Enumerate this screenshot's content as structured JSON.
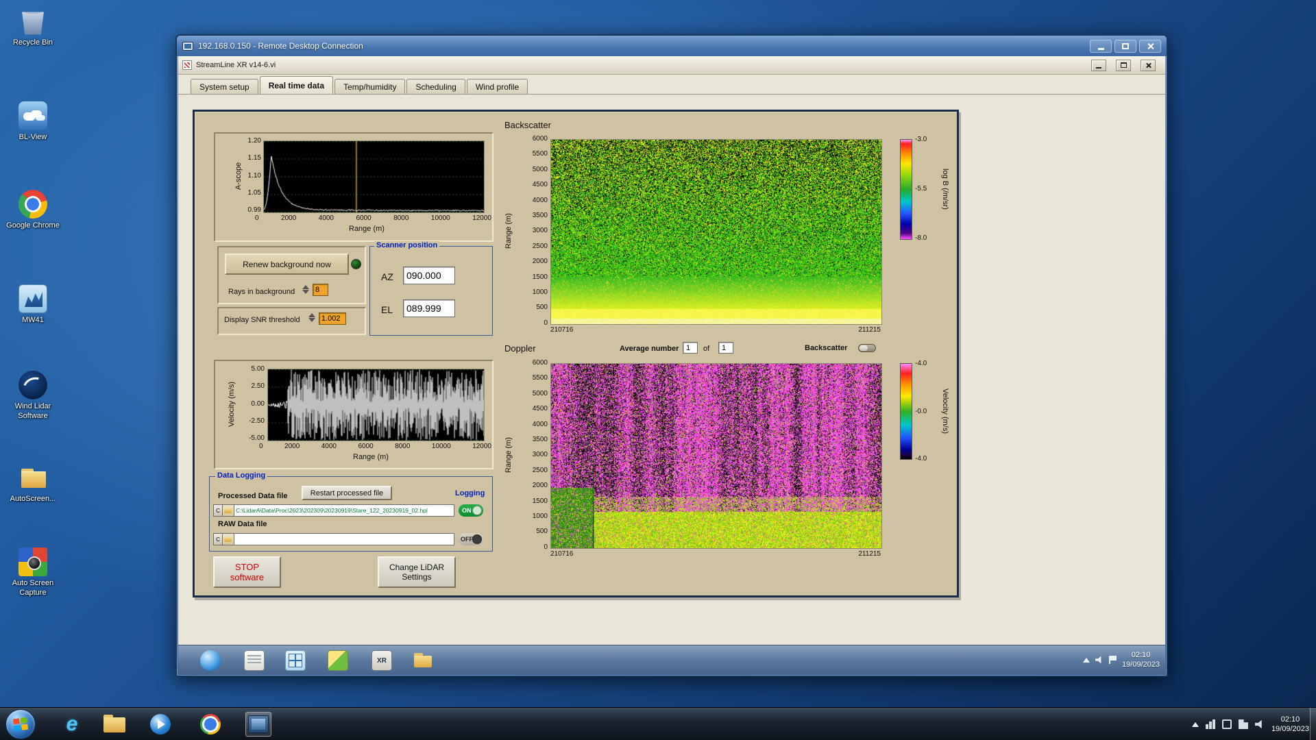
{
  "desktop": {
    "icons": [
      {
        "id": "recycle-bin",
        "label": "Recycle Bin"
      },
      {
        "id": "bl-view",
        "label": "BL-View"
      },
      {
        "id": "google-chrome",
        "label": "Google Chrome"
      },
      {
        "id": "mw41",
        "label": "MW41"
      },
      {
        "id": "wind-lidar",
        "label": "Wind Lidar Software"
      },
      {
        "id": "autoscreen",
        "label": "AutoScreen..."
      },
      {
        "id": "auto-screen-capture",
        "label": "Auto Screen Capture"
      }
    ]
  },
  "rdp": {
    "title": "192.168.0.150 - Remote Desktop Connection"
  },
  "app": {
    "title": "StreamLine XR v14-6.vi",
    "tabs": [
      {
        "label": "System setup"
      },
      {
        "label": "Real time data"
      },
      {
        "label": "Temp/humidity"
      },
      {
        "label": "Scheduling"
      },
      {
        "label": "Wind profile"
      }
    ],
    "ascope": {
      "ylabel": "A-scope",
      "yticks": [
        "1.20",
        "1.15",
        "1.10",
        "1.05",
        "0.99"
      ],
      "xticks": [
        "0",
        "2000",
        "4000",
        "6000",
        "8000",
        "10000",
        "12000"
      ],
      "xlabel": "Range (m)"
    },
    "background_controls": {
      "renew_button": "Renew background now",
      "rays_label": "Rays in background",
      "rays_value": "8",
      "snr_label": "Display SNR threshold",
      "snr_value": "1.002"
    },
    "scanner": {
      "title": "Scanner position",
      "az_label": "AZ",
      "az_value": "090.000",
      "el_label": "EL",
      "el_value": "089.999"
    },
    "backscatter": {
      "title": "Backscatter",
      "ylabel": "Range (m)",
      "yticks": [
        "6000",
        "5500",
        "5000",
        "4500",
        "4000",
        "3500",
        "3000",
        "2500",
        "2000",
        "1500",
        "1000",
        "500",
        "0"
      ],
      "xtick_left": "210716",
      "xtick_right": "211215",
      "colorbar_label": "log B (/m/sr)",
      "colorbar_ticks": [
        "-3.0",
        "-5.5",
        "-8.0"
      ]
    },
    "doppler_header": {
      "title": "Doppler",
      "avg_label": "Average number",
      "avg_value": "1",
      "of_label": "of",
      "avg_total": "1",
      "toggle_label": "Backscatter"
    },
    "doppler": {
      "ylabel": "Range (m)",
      "yticks": [
        "6000",
        "5500",
        "5000",
        "4500",
        "4000",
        "3500",
        "3000",
        "2500",
        "2000",
        "1500",
        "1000",
        "500",
        "0"
      ],
      "xtick_left": "210716",
      "xtick_right": "211215",
      "colorbar_label": "Velocity (m/s)",
      "colorbar_ticks": [
        "-4.0",
        "-0.0",
        "-4.0"
      ]
    },
    "velocity": {
      "ylabel": "Velocity (m/s)",
      "yticks": [
        "5.00",
        "2.50",
        "0.00",
        "-2.50",
        "-5.00"
      ],
      "xticks": [
        "0",
        "2000",
        "4000",
        "6000",
        "8000",
        "10000",
        "12000"
      ],
      "xlabel": "Range (m)"
    },
    "logging": {
      "title": "Data Logging",
      "processed_label": "Processed Data file",
      "restart_button": "Restart processed file",
      "logging_label": "Logging",
      "drive_letter": "C",
      "processed_path": "C:\\LidarA\\Data\\Proc\\2023\\202309\\20230919\\Stare_122_20230919_02.hpl",
      "on_label": "ON",
      "raw_label": "RAW Data file",
      "raw_path": "",
      "off_label": "OFF"
    },
    "actions": {
      "stop_line1": "STOP",
      "stop_line2": "software",
      "change_line1": "Change LiDAR",
      "change_line2": "Settings"
    }
  },
  "remote_taskbar": {
    "time": "02:10",
    "date": "19/09/2023",
    "xr_label": "XR"
  },
  "host_taskbar": {
    "time": "02:10",
    "date": "19/09/2023",
    "ie_letter": "e"
  },
  "chart_data": [
    {
      "id": "ascope",
      "type": "line",
      "title": "A-scope",
      "xlabel": "Range (m)",
      "ylabel": "A-scope",
      "xlim": [
        0,
        12000
      ],
      "ylim": [
        0.99,
        1.2
      ],
      "xticks": [
        0,
        2000,
        4000,
        6000,
        8000,
        10000,
        12000
      ],
      "yticks": [
        1.2,
        1.15,
        1.1,
        1.05,
        0.99
      ],
      "description": "Background A-scope trace rising from ~1.01 at 0 m to a peak of ~1.15 near 400 m, decaying to ~1.00 by 2000 m, then flat noisy baseline ~0.995 out to 12000 m; yellow cursor line near 5000 m",
      "peak_value": 1.155,
      "peak_range_m": 400,
      "baseline": 0.9955,
      "cursor_frac": 0.42,
      "bg_color": "#000000",
      "line_color": "#ffffff",
      "grid_color": "#25522b",
      "cursor_color": "#b8a41e"
    },
    {
      "id": "velocity",
      "type": "line",
      "xlabel": "Range (m)",
      "ylabel": "Velocity (m/s)",
      "xlim": [
        0,
        12000
      ],
      "ylim": [
        -5,
        5
      ],
      "xticks": [
        0,
        2000,
        4000,
        6000,
        8000,
        10000,
        12000
      ],
      "yticks": [
        5.0,
        2.5,
        0.0,
        -2.5,
        -5.0
      ],
      "description": "Raw Doppler velocity vs range: near 0 m/s below ~1100 m then broadband noise spanning roughly ±5 m/s out to 12000 m",
      "noise_start_m": 1100,
      "bg_color": "#000000",
      "line_color": "#ffffff",
      "grid_color": "#25522b"
    },
    {
      "id": "backscatter",
      "type": "heatmap",
      "title": "Backscatter",
      "ylabel": "Range (m)",
      "ylim": [
        0,
        6000
      ],
      "xticks": [
        "210716",
        "211215"
      ],
      "colorbar_label": "log B (/m/sr)",
      "colorbar_ticks": [
        -3.0,
        -5.5,
        -8.0
      ],
      "description": "Time-height attenuated backscatter 21:07:16-21:12:15: strong yellow layer below ~500 m, solid green to ~1600 m, speckled green/yellow with increasing black dropouts aloft"
    },
    {
      "id": "doppler",
      "type": "heatmap",
      "title": "Doppler",
      "ylabel": "Range (m)",
      "ylim": [
        0,
        6000
      ],
      "xticks": [
        "210716",
        "211215"
      ],
      "colorbar_label": "Velocity (m/s)",
      "colorbar_ticks": [
        -4.0,
        -0.0,
        -4.0
      ],
      "description": "Time-height Doppler velocity 21:07:16-21:12:15: coherent green/yellow returns below ~1500 m, noisy magenta vertical streaks aloft, dark green patch bottom-left"
    }
  ]
}
